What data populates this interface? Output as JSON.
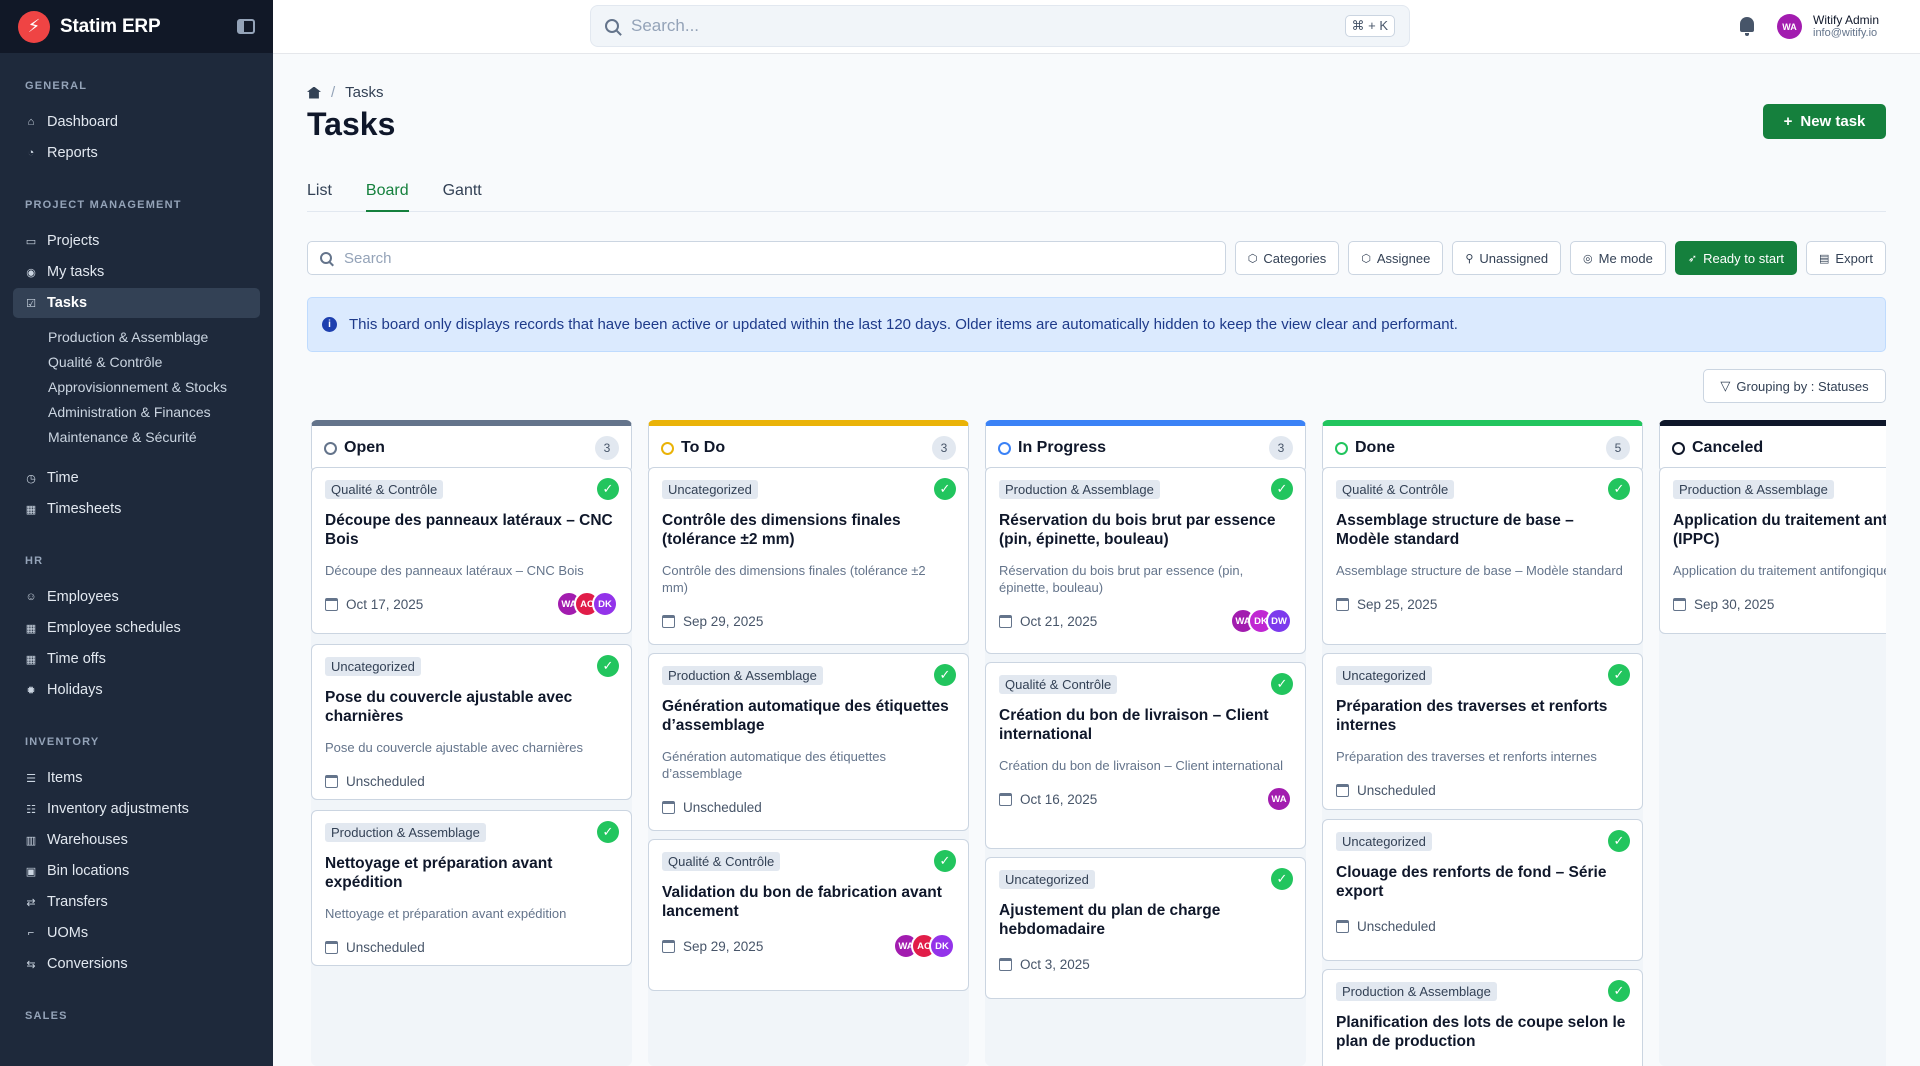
{
  "app": {
    "brand": "Statim ERP",
    "logo_glyph": "⚡"
  },
  "topbar": {
    "search_placeholder": "Search...",
    "shortcut": "⌘ + K",
    "user_initials": "WA",
    "user_name": "Witify Admin",
    "user_email": "info@witify.io"
  },
  "sidebar": {
    "sections": [
      {
        "label": "GENERAL",
        "items": [
          {
            "label": "Dashboard",
            "icon": "home-icon"
          },
          {
            "label": "Reports",
            "icon": "pie-chart-icon"
          }
        ]
      },
      {
        "label": "PROJECT MANAGEMENT",
        "items": [
          {
            "label": "Projects",
            "icon": "folder-icon"
          },
          {
            "label": "My tasks",
            "icon": "user-circle-icon"
          },
          {
            "label": "Tasks",
            "icon": "tasks-icon",
            "active": true
          }
        ]
      },
      {
        "label": "HR",
        "items": [
          {
            "label": "Employees",
            "icon": "users-icon"
          },
          {
            "label": "Employee schedules",
            "icon": "calendar-icon"
          },
          {
            "label": "Time offs",
            "icon": "calendar-icon"
          },
          {
            "label": "Holidays",
            "icon": "sun-icon"
          }
        ]
      },
      {
        "label": "INVENTORY",
        "items": [
          {
            "label": "Items",
            "icon": "list-icon"
          },
          {
            "label": "Inventory adjustments",
            "icon": "adjust-icon"
          },
          {
            "label": "Warehouses",
            "icon": "building-icon"
          },
          {
            "label": "Bin locations",
            "icon": "box-icon"
          },
          {
            "label": "Transfers",
            "icon": "transfer-icon"
          },
          {
            "label": "UOMs",
            "icon": "ruler-icon"
          },
          {
            "label": "Conversions",
            "icon": "convert-icon"
          }
        ]
      },
      {
        "label": "SALES",
        "items": []
      }
    ],
    "time_items": [
      {
        "label": "Time",
        "icon": "clock-icon"
      },
      {
        "label": "Timesheets",
        "icon": "calendar-icon"
      }
    ],
    "task_categories": [
      "Production & Assemblage",
      "Qualité & Contrôle",
      "Approvisionnement & Stocks",
      "Administration & Finances",
      "Maintenance & Sécurité"
    ]
  },
  "page": {
    "breadcrumb": "Tasks",
    "title": "Tasks",
    "new_task_label": "New task",
    "tabs": [
      "List",
      "Board",
      "Gantt"
    ],
    "active_tab": "Board",
    "search_placeholder": "Search",
    "filters": [
      "Categories",
      "Assignee",
      "Unassigned",
      "Me mode"
    ],
    "ready_label": "Ready to start",
    "export_label": "Export",
    "notice": "This board only displays records that have been active or updated within the last 120 days. Older items are automatically hidden to keep the view clear and performant.",
    "grouping_label": "Grouping by : Statuses"
  },
  "colors": {
    "open": "#64748b",
    "todo": "#eab308",
    "in_progress": "#3b82f6",
    "done": "#22c55e",
    "canceled": "#0f172a",
    "accent": "#15803d"
  },
  "board": {
    "columns": [
      {
        "name": "Open",
        "count": "3",
        "color": "#64748b",
        "cards": [
          {
            "tag": "Qualité & Contrôle",
            "title": "Découpe des panneaux latéraux – CNC Bois",
            "desc": "Découpe des panneaux latéraux – CNC Bois",
            "date": "Oct 17, 2025",
            "avatars": [
              {
                "i": "WA",
                "c": "#a21caf"
              },
              {
                "i": "AC",
                "c": "#e11d48"
              },
              {
                "i": "DK",
                "c": "#9333ea"
              }
            ]
          },
          {
            "tag": "Uncategorized",
            "title": "Pose du couvercle ajustable avec charnières",
            "desc": "Pose du couvercle ajustable avec charnières",
            "date": "Unscheduled",
            "avatars": []
          },
          {
            "tag": "Production & Assemblage",
            "title": "Nettoyage et préparation avant expédition",
            "desc": "Nettoyage et préparation avant expédition",
            "date": "Unscheduled",
            "avatars": []
          }
        ]
      },
      {
        "name": "To Do",
        "count": "3",
        "color": "#eab308",
        "cards": [
          {
            "tag": "Uncategorized",
            "title": "Contrôle des dimensions finales (tolérance ±2 mm)",
            "desc": "Contrôle des dimensions finales (tolérance ±2 mm)",
            "date": "Sep 29, 2025",
            "avatars": []
          },
          {
            "tag": "Production & Assemblage",
            "title": "Génération automatique des étiquettes d’assemblage",
            "desc": "Génération automatique des étiquettes d’assemblage",
            "date": "Unscheduled",
            "avatars": []
          },
          {
            "tag": "Qualité & Contrôle",
            "title": "Validation du bon de fabrication avant lancement",
            "desc": "",
            "date": "Sep 29, 2025",
            "avatars": [
              {
                "i": "WA",
                "c": "#a21caf"
              },
              {
                "i": "AC",
                "c": "#e11d48"
              },
              {
                "i": "DK",
                "c": "#9333ea"
              }
            ]
          }
        ]
      },
      {
        "name": "In Progress",
        "count": "3",
        "color": "#3b82f6",
        "cards": [
          {
            "tag": "Production & Assemblage",
            "title": "Réservation du bois brut par essence (pin, épinette, bouleau)",
            "desc": "Réservation du bois brut par essence (pin, épinette, bouleau)",
            "date": "Oct 21, 2025",
            "avatars": [
              {
                "i": "WA",
                "c": "#a21caf"
              },
              {
                "i": "DK",
                "c": "#c026d3"
              },
              {
                "i": "DW",
                "c": "#7c3aed"
              }
            ]
          },
          {
            "tag": "Qualité & Contrôle",
            "title": "Création du bon de livraison – Client international",
            "desc": "Création du bon de livraison – Client international",
            "date": "Oct 16, 2025",
            "avatars": [
              {
                "i": "WA",
                "c": "#a21caf"
              }
            ]
          },
          {
            "tag": "Uncategorized",
            "title": "Ajustement du plan de charge hebdomadaire",
            "desc": "",
            "date": "Oct 3, 2025",
            "avatars": []
          }
        ]
      },
      {
        "name": "Done",
        "count": "5",
        "color": "#22c55e",
        "cards": [
          {
            "tag": "Qualité & Contrôle",
            "title": "Assemblage structure de base – Modèle standard",
            "desc": "Assemblage structure de base – Modèle standard",
            "date": "Sep 25, 2025",
            "avatars": []
          },
          {
            "tag": "Uncategorized",
            "title": "Préparation des traverses et renforts internes",
            "desc": "Préparation des traverses et renforts internes",
            "date": "Unscheduled",
            "avatars": []
          },
          {
            "tag": "Uncategorized",
            "title": "Clouage des renforts de fond – Série export",
            "desc": "",
            "date": "Unscheduled",
            "avatars": []
          },
          {
            "tag": "Production & Assemblage",
            "title": "Planification des lots de coupe selon le plan de production",
            "desc": "",
            "date": "",
            "avatars": []
          }
        ]
      },
      {
        "name": "Canceled",
        "count": "",
        "color": "#0f172a",
        "cards": [
          {
            "tag": "Production & Assemblage",
            "title": "Application du traitement antifongique (IPPC)",
            "desc": "Application du traitement antifongique",
            "date": "Sep 30, 2025",
            "avatars": []
          }
        ]
      }
    ]
  }
}
